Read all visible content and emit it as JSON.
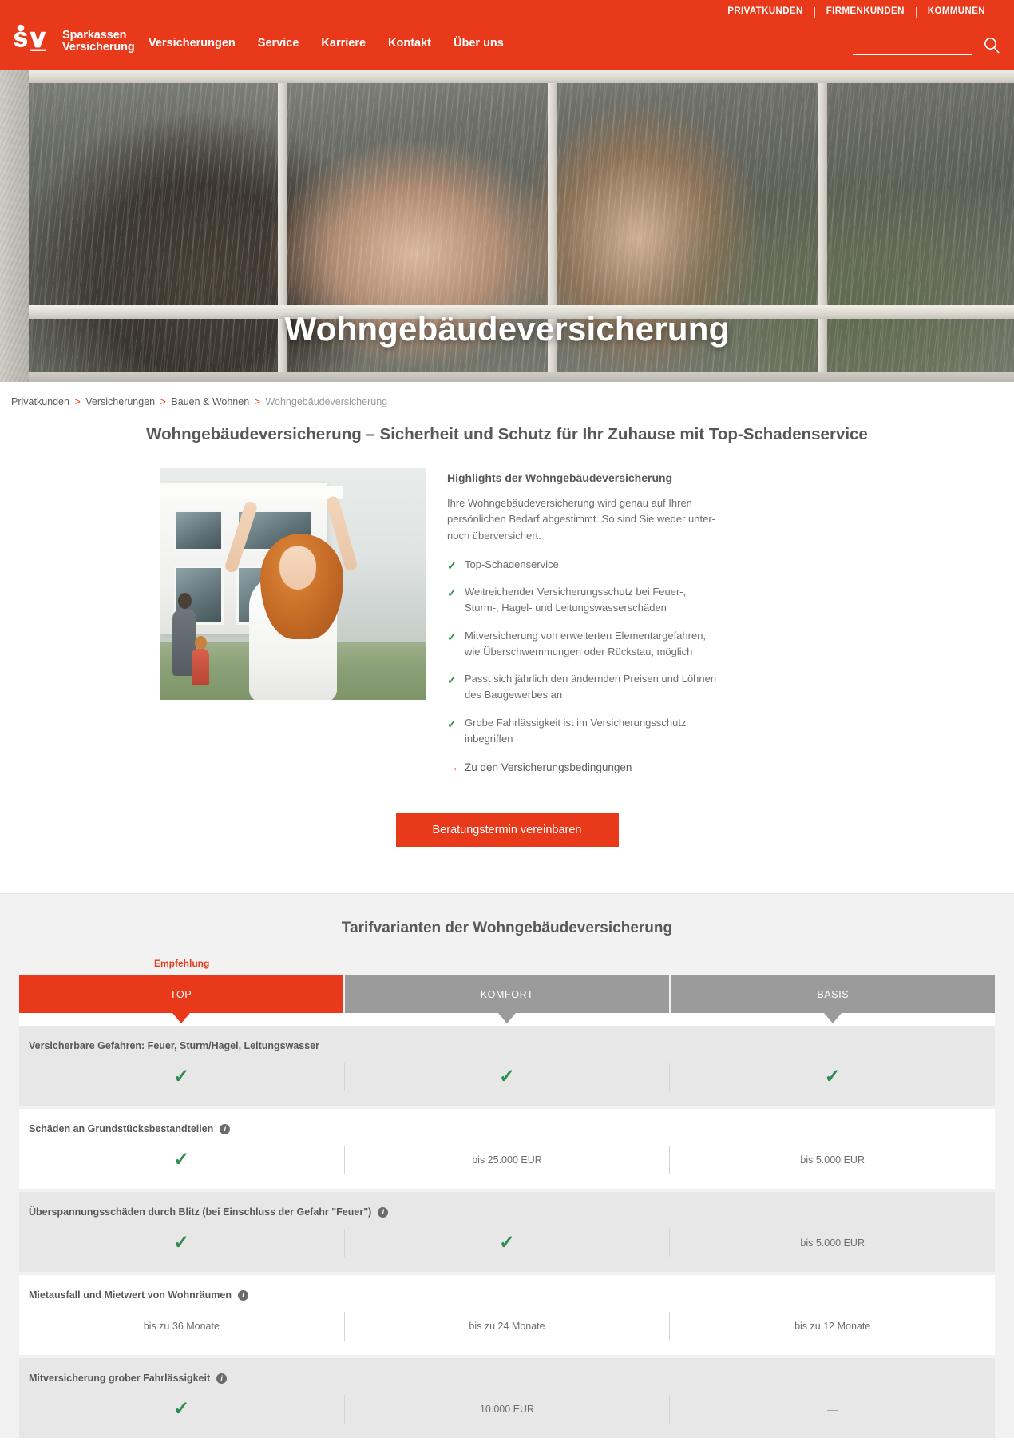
{
  "brand": {
    "accent": "#e8391b",
    "logo_line1": "Sparkassen",
    "logo_line2": "Versicherung"
  },
  "header": {
    "utility_links": [
      "PRIVATKUNDEN",
      "FIRMENKUNDEN",
      "KOMMUNEN"
    ],
    "nav": [
      "Versicherungen",
      "Service",
      "Karriere",
      "Kontakt",
      "Über uns"
    ],
    "search": {
      "value": "",
      "placeholder": ""
    }
  },
  "hero": {
    "title": "Wohngebäudeversicherung"
  },
  "breadcrumb": {
    "items": [
      "Privatkunden",
      "Versicherungen",
      "Bauen & Wohnen",
      "Wohngebäudeversicherung"
    ],
    "separator": ">"
  },
  "main": {
    "page_title": "Wohngebäudeversicherung – Sicherheit und Schutz für Ihr Zuhause mit Top-Schadenservice",
    "highlights": {
      "heading": "Highlights der Wohngebäudeversicherung",
      "intro": "Ihre Wohngebäudeversicherung wird genau auf Ihren persönlichen Bedarf abgestimmt. So sind Sie weder unter- noch überversichert.",
      "items": [
        "Top-Schadenservice",
        "Weitreichender Versicherungsschutz bei Feuer-, Sturm-, Hagel- und Leitungswasserschäden",
        "Mitversicherung von erweiterten Elementargefahren, wie Überschwemmungen oder Rückstau, möglich",
        "Passt sich jährlich den ändernden Preisen und Löhnen des Baugewerbes an",
        "Grobe Fahrlässigkeit ist im Versicherungsschutz inbegriffen"
      ],
      "link": "Zu den Versicherungsbedingungen",
      "check_glyph": "✓",
      "arrow_glyph": "→"
    },
    "cta": "Beratungstermin vereinbaren"
  },
  "tariff": {
    "title": "Tarifvarianten der Wohngebäudeversicherung",
    "recommendation_label": "Empfehlung",
    "columns": [
      {
        "label": "TOP",
        "recommended": true
      },
      {
        "label": "KOMFORT",
        "recommended": false
      },
      {
        "label": "BASIS",
        "recommended": false
      }
    ],
    "check_glyph": "✓",
    "dash_glyph": "—",
    "info_glyph": "i",
    "rows": [
      {
        "label": "Versicherbare Gefahren: Feuer, Sturm/Hagel, Leitungswasser",
        "has_info": false,
        "values": [
          "✓",
          "✓",
          "✓"
        ]
      },
      {
        "label": "Schäden an Grundstücksbestandteilen",
        "has_info": true,
        "values": [
          "✓",
          "bis 25.000 EUR",
          "bis 5.000 EUR"
        ]
      },
      {
        "label": "Überspannungsschäden durch Blitz (bei Einschluss der Gefahr \"Feuer\")",
        "has_info": true,
        "values": [
          "✓",
          "✓",
          "bis 5.000 EUR"
        ]
      },
      {
        "label": "Mietausfall und Mietwert von Wohnräumen",
        "has_info": true,
        "values": [
          "bis zu 36 Monate",
          "bis zu 24 Monate",
          "bis zu 12 Monate"
        ]
      },
      {
        "label": "Mitversicherung grober Fahrlässigkeit",
        "has_info": true,
        "values": [
          "✓",
          "10.000 EUR",
          "—"
        ]
      }
    ]
  }
}
